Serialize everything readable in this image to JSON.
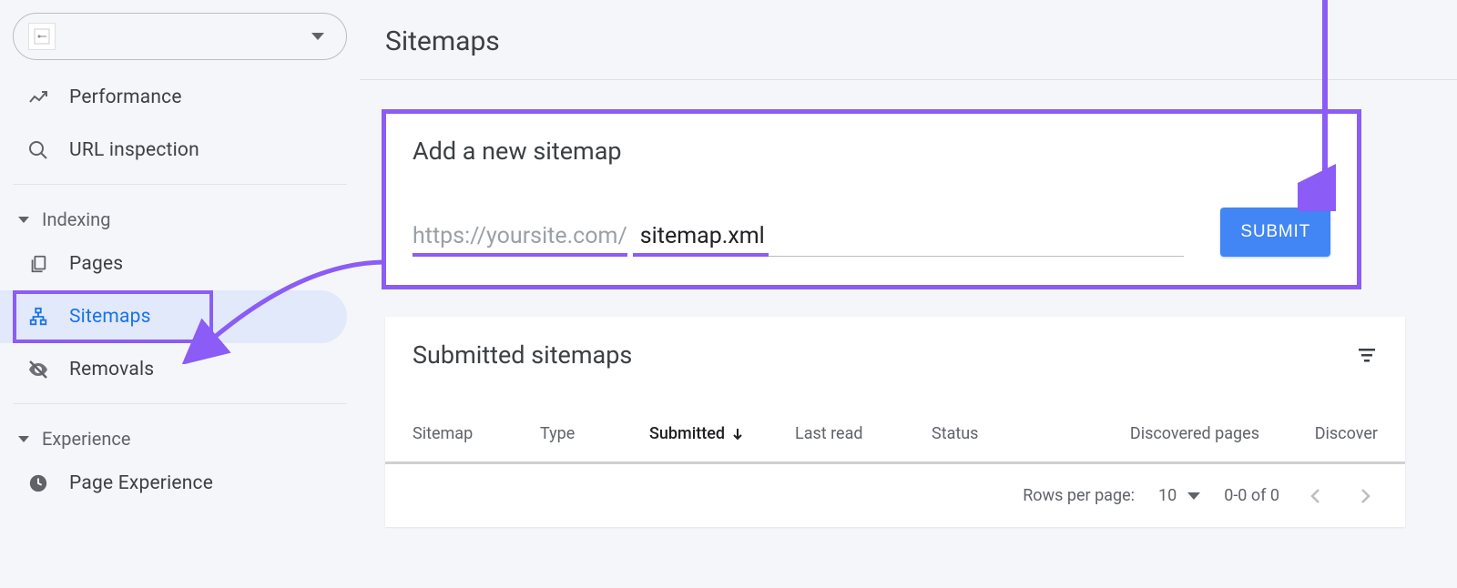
{
  "page": {
    "title": "Sitemaps"
  },
  "sidebar": {
    "nav": {
      "performance": "Performance",
      "url_inspection": "URL inspection"
    },
    "groups": {
      "indexing": "Indexing",
      "experience": "Experience"
    },
    "indexing": {
      "pages": "Pages",
      "sitemaps": "Sitemaps",
      "removals": "Removals"
    },
    "experience_items": {
      "page_experience": "Page Experience"
    }
  },
  "add_sitemap": {
    "heading": "Add a new sitemap",
    "url_prefix": "https://yoursite.com/",
    "input_value": "sitemap.xml",
    "submit_label": "SUBMIT"
  },
  "submitted": {
    "heading": "Submitted sitemaps",
    "columns": {
      "sitemap": "Sitemap",
      "type": "Type",
      "submitted": "Submitted",
      "last_read": "Last read",
      "status": "Status",
      "discovered_pages": "Discovered pages",
      "discovered_trunc": "Discover"
    },
    "footer": {
      "rows_per_page": "Rows per page:",
      "rpp_value": "10",
      "range": "0-0 of 0"
    }
  },
  "colors": {
    "highlight": "#8b5cf6",
    "primary": "#4285f4"
  }
}
